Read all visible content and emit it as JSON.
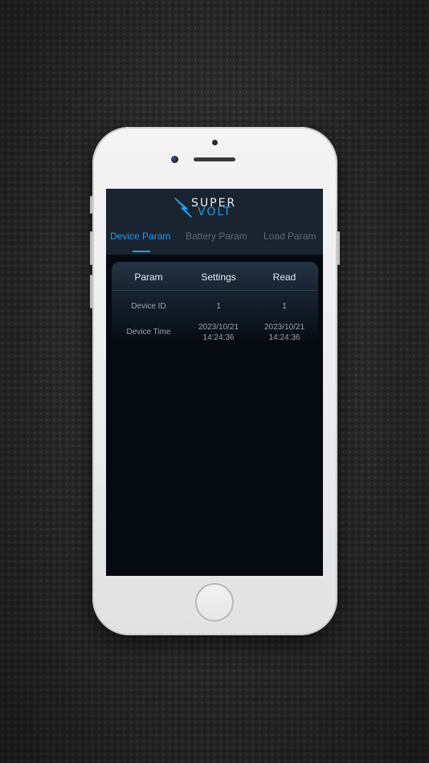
{
  "app": {
    "logo_line1": "SUPER",
    "logo_line2": "VOLT"
  },
  "tabs": [
    {
      "label": "Device Param",
      "active": true
    },
    {
      "label": "Battery Param",
      "active": false
    },
    {
      "label": "Load Param",
      "active": false
    }
  ],
  "table": {
    "headers": [
      "Param",
      "Settings",
      "Read"
    ],
    "rows": [
      {
        "param": "Device ID",
        "settings": "1",
        "read": "1"
      },
      {
        "param": "Device Time",
        "settings_date": "2023/10/21",
        "settings_time": "14:24:36",
        "read_date": "2023/10/21",
        "read_time": "14:24:36"
      }
    ]
  },
  "colors": {
    "accent": "#1f9be8",
    "inactive_tab": "#5c6a78",
    "screen_bg": "#050a10",
    "header_bg": "#1a2430"
  }
}
